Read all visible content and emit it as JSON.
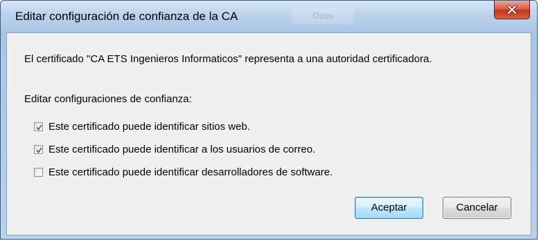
{
  "window": {
    "title": "Editar configuración de confianza de la CA",
    "background_tab_label": "Otros",
    "close_icon": "close-x-icon"
  },
  "dialog": {
    "message": "El certificado \"CA ETS Ingenieros Informaticos\" representa a una autoridad certificadora.",
    "section_label": "Editar configuraciones de confianza:",
    "options": [
      {
        "label": "Este certificado puede identificar sitios web.",
        "checked": true
      },
      {
        "label": "Este certificado puede identificar a los usuarios de correo.",
        "checked": true
      },
      {
        "label": "Este certificado puede identificar desarrolladores de software.",
        "checked": false
      }
    ]
  },
  "buttons": {
    "accept_label": "Aceptar",
    "cancel_label": "Cancelar"
  },
  "colors": {
    "frame": "#b9d1ea",
    "client_bg": "#f0f0f0",
    "close_red": "#c2351b",
    "default_button_border": "#3c7fb1",
    "checkmark": "#4a5f97"
  }
}
